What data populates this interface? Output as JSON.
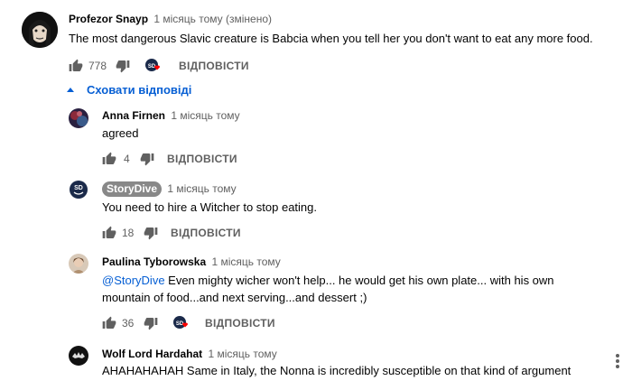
{
  "main_comment": {
    "author": "Profezor Snayp",
    "time": "1 місяць тому (змінено)",
    "text": "The most dangerous Slavic creature is Babcia when you tell her you don't want to eat any more food.",
    "likes": "778",
    "reply_label": "ВІДПОВІСТИ"
  },
  "replies_toggle": {
    "label": "Сховати відповіді"
  },
  "replies": [
    {
      "author": "Anna Firnen",
      "time": "1 місяць тому",
      "text": "agreed",
      "likes": "4",
      "reply_label": "ВІДПОВІСТИ"
    },
    {
      "author": "StoryDive",
      "time": "1 місяць тому",
      "text": "You need to hire a Witcher to stop eating.",
      "likes": "18",
      "reply_label": "ВІДПОВІСТИ"
    },
    {
      "author": "Paulina Tyborowska",
      "time": "1 місяць тому",
      "mention": "@StoryDive",
      "text_line1": " Even mighty wicher won't help... he would get his own plate... with his own",
      "text_line2": "mountain of food...and next serving...and dessert ;)",
      "likes": "36",
      "reply_label": "ВІДПОВІСТИ"
    },
    {
      "author": "Wolf Lord Hardahat",
      "time": "1 місяць тому",
      "text": "AHAHAHAHAH Same in Italy, the Nonna is incredibly susceptible on that kind of argument"
    }
  ],
  "icons": {
    "like": "thumb-up-icon",
    "dislike": "thumb-down-icon",
    "creator_heart": "creator-heart-icon",
    "more": "more-vertical-icon",
    "toggle": "triangle-up-icon"
  },
  "colors": {
    "link": "#065fd4",
    "heart": "#ff0000",
    "muted": "#606060"
  }
}
